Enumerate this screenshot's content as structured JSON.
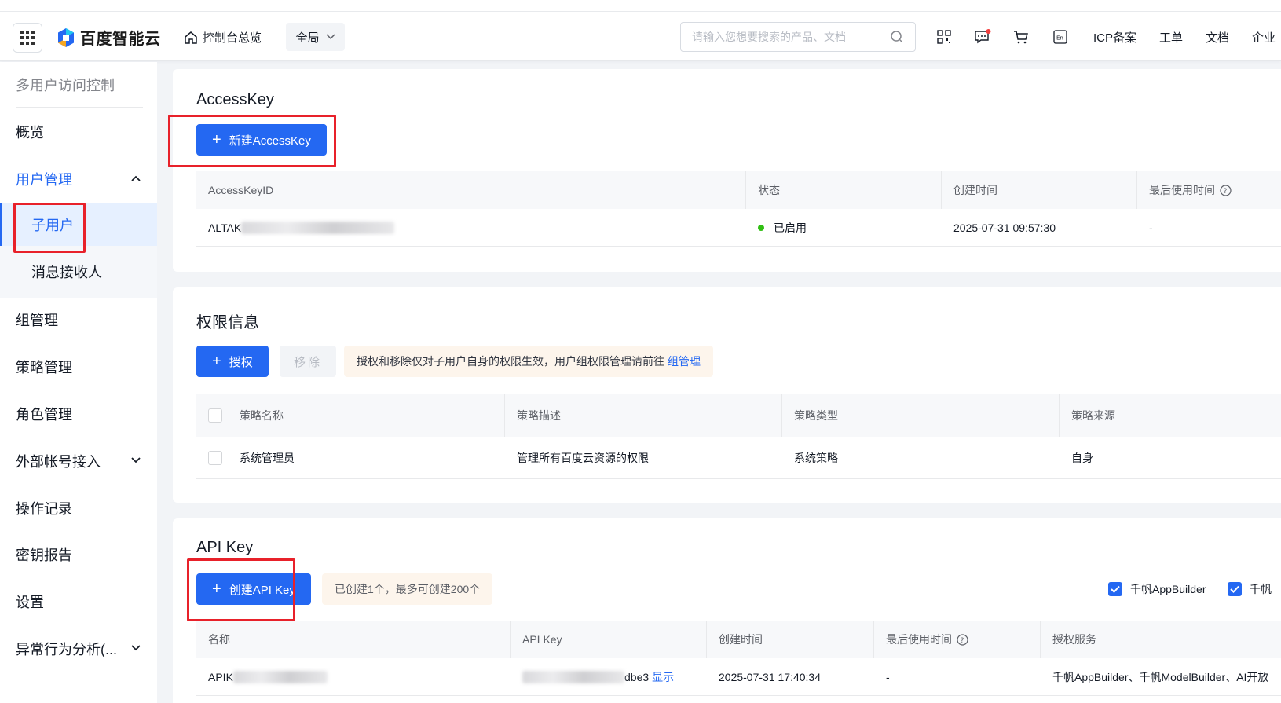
{
  "header": {
    "brand": "百度智能云",
    "console_home": "控制台总览",
    "region": "全局",
    "search_placeholder": "请输入您想要搜索的产品、文档",
    "links": [
      "ICP备案",
      "工单",
      "文档",
      "企业"
    ]
  },
  "sidebar": {
    "title": "多用户访问控制",
    "items": [
      "概览",
      "用户管理",
      "组管理",
      "策略管理",
      "角色管理",
      "外部帐号接入",
      "操作记录",
      "密钥报告",
      "设置",
      "异常行为分析(..."
    ],
    "sub_items": [
      "子用户",
      "消息接收人"
    ]
  },
  "accesskey": {
    "title": "AccessKey",
    "create_label": "新建AccessKey",
    "columns": [
      "AccessKeyID",
      "状态",
      "创建时间",
      "最后使用时间"
    ],
    "rows": [
      {
        "id_prefix": "ALTAK",
        "status": "已启用",
        "created": "2025-07-31 09:57:30",
        "last_used": "-"
      }
    ]
  },
  "permissions": {
    "title": "权限信息",
    "grant_label": "授权",
    "remove_label": "移除",
    "tip_text": "授权和移除仅对子用户自身的权限生效，用户组权限管理请前往",
    "tip_link": "组管理",
    "columns": [
      "策略名称",
      "策略描述",
      "策略类型",
      "策略来源"
    ],
    "rows": [
      {
        "name": "系统管理员",
        "desc": "管理所有百度云资源的权限",
        "type": "系统策略",
        "source": "自身"
      }
    ]
  },
  "apikey": {
    "title": "API Key",
    "create_label": "创建API Key",
    "quota_text": "已创建1个，最多可创建200个",
    "service_filters": [
      "千帆AppBuilder",
      "千帆"
    ],
    "columns": [
      "名称",
      "API Key",
      "创建时间",
      "最后使用时间",
      "授权服务"
    ],
    "rows": [
      {
        "name_prefix": "APIK",
        "key_suffix": "dbe3",
        "show_label": "显示",
        "created": "2025-07-31 17:40:34",
        "last_used": "-",
        "services": "千帆AppBuilder、千帆ModelBuilder、AI开放"
      }
    ]
  },
  "colors": {
    "primary": "#2468f2",
    "highlight": "#e8212a",
    "success": "#30bf13"
  }
}
